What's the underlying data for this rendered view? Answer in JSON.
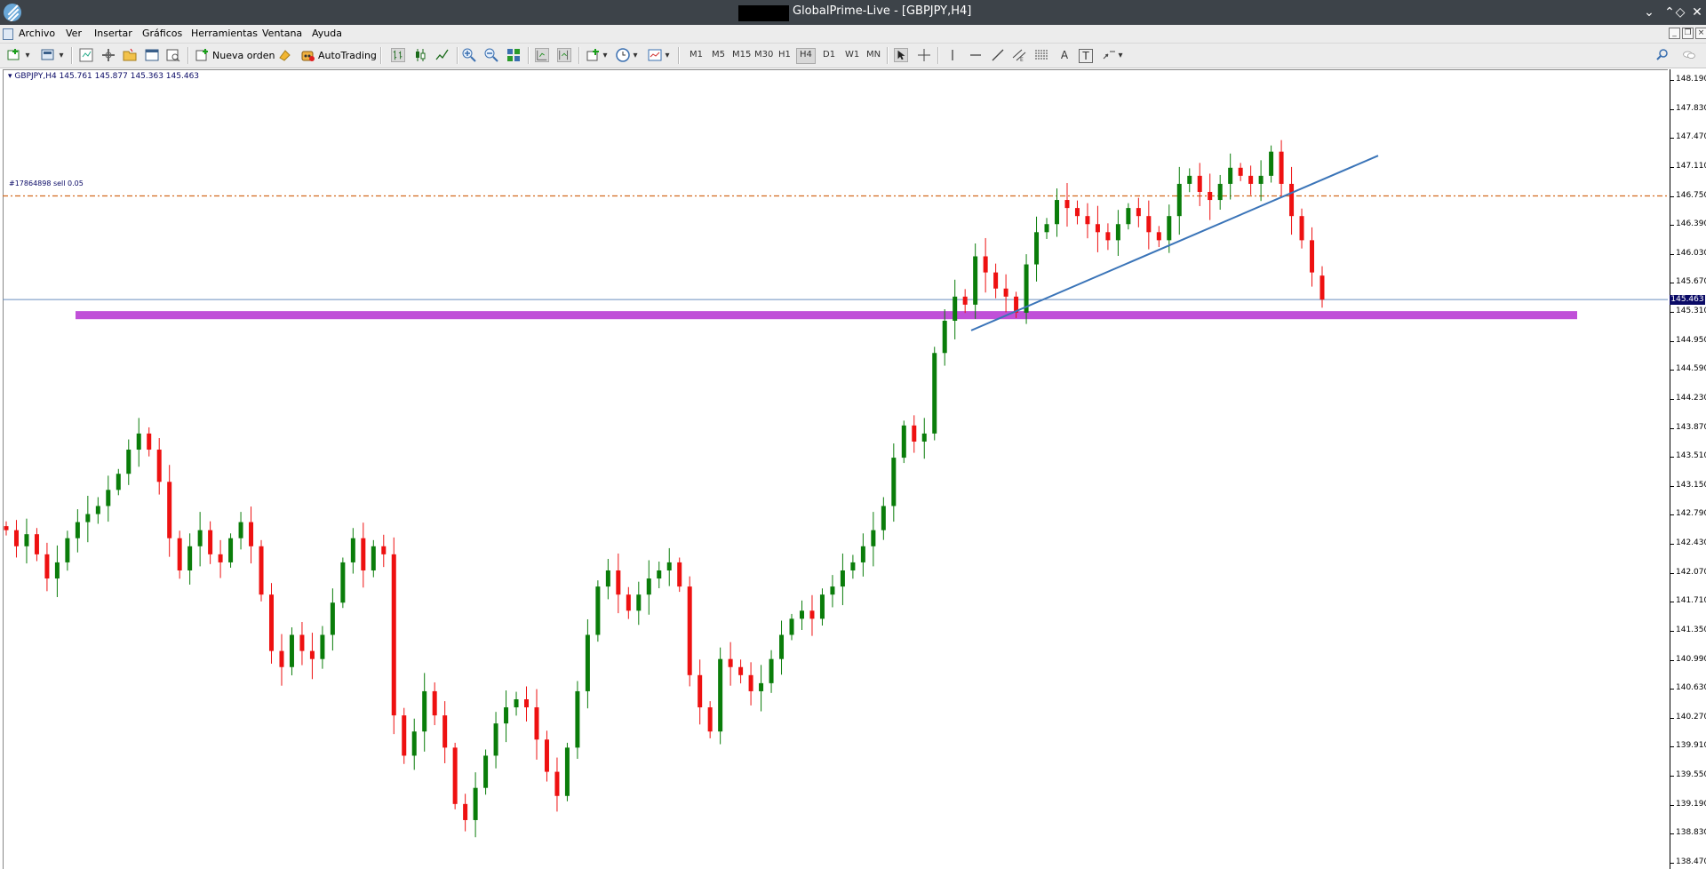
{
  "window": {
    "title": "GlobalPrime-Live - [GBPJPY,H4]",
    "controls": [
      "⌄",
      "⌃",
      "◇",
      "✕"
    ]
  },
  "menu": {
    "items": [
      {
        "label": "Archivo"
      },
      {
        "label": "Ver"
      },
      {
        "label": "Insertar"
      },
      {
        "label": "Gráficos"
      },
      {
        "label": "Herramientas"
      },
      {
        "label": "Ventana"
      },
      {
        "label": "Ayuda"
      }
    ]
  },
  "toolbar": {
    "new_order_label": "Nueva orden",
    "autotrading_label": "AutoTrading",
    "timeframes": [
      "M1",
      "M5",
      "M15",
      "M30",
      "H1",
      "H4",
      "D1",
      "W1",
      "MN"
    ],
    "active_timeframe": "H4",
    "text_tool_label": "A",
    "textbox_tool_label": "T"
  },
  "chart": {
    "header": "GBPJPY,H4  145.761 145.877 145.363 145.463",
    "order_label": "#17864898 sell 0.05",
    "current_price": "145.463",
    "colors": {
      "bull": "#0a7d0a",
      "bear": "#ee1111",
      "support_zone": "#c050d8",
      "trendline": "#3a74b8",
      "order_line": "#d2691e",
      "bid_line": "#6a8fbf"
    },
    "price_scale": [
      "148.190",
      "147.830",
      "147.470",
      "147.110",
      "146.750",
      "146.390",
      "146.030",
      "145.670",
      "145.310",
      "144.950",
      "144.590",
      "144.230",
      "143.870",
      "143.510",
      "143.150",
      "142.790",
      "142.430",
      "142.070",
      "141.710",
      "141.350",
      "140.990",
      "140.630",
      "140.270",
      "139.910",
      "139.550",
      "139.190",
      "138.830",
      "138.470"
    ]
  },
  "chart_data": {
    "type": "candlestick",
    "symbol": "GBPJPY",
    "timeframe": "H4",
    "last_bar": {
      "open": 145.761,
      "high": 145.877,
      "low": 145.363,
      "close": 145.463
    },
    "order_level": 146.75,
    "support_zone": [
      145.22,
      145.32
    ],
    "ylim": [
      138.47,
      148.19
    ],
    "closes": [
      142.6,
      142.4,
      142.55,
      142.3,
      142.0,
      142.2,
      142.5,
      142.7,
      142.8,
      142.9,
      143.1,
      143.3,
      143.6,
      143.8,
      143.6,
      143.2,
      142.5,
      142.1,
      142.4,
      142.6,
      142.3,
      142.2,
      142.5,
      142.7,
      142.4,
      141.8,
      141.1,
      140.9,
      141.3,
      141.1,
      141.0,
      141.3,
      141.7,
      142.2,
      142.5,
      142.1,
      142.4,
      142.3,
      140.3,
      139.8,
      140.1,
      140.6,
      140.3,
      139.9,
      139.2,
      139.0,
      139.4,
      139.8,
      140.2,
      140.4,
      140.5,
      140.4,
      140.0,
      139.6,
      139.3,
      139.9,
      140.6,
      141.3,
      141.9,
      142.1,
      141.8,
      141.6,
      141.8,
      142.0,
      142.1,
      142.2,
      141.9,
      140.8,
      140.4,
      140.1,
      141.0,
      140.9,
      140.8,
      140.6,
      140.7,
      141.0,
      141.3,
      141.5,
      141.6,
      141.5,
      141.8,
      141.9,
      142.1,
      142.2,
      142.4,
      142.6,
      142.9,
      143.5,
      143.9,
      143.7,
      143.8,
      144.8,
      145.2,
      145.5,
      145.4,
      146.0,
      145.8,
      145.6,
      145.5,
      145.3,
      145.9,
      146.3,
      146.4,
      146.7,
      146.6,
      146.5,
      146.4,
      146.3,
      146.2,
      146.4,
      146.6,
      146.5,
      146.3,
      146.2,
      146.5,
      146.9,
      147.0,
      146.8,
      146.7,
      146.9,
      147.1,
      147.0,
      146.9,
      147.0,
      147.3,
      146.9,
      146.5,
      146.2,
      145.8,
      145.463
    ]
  }
}
